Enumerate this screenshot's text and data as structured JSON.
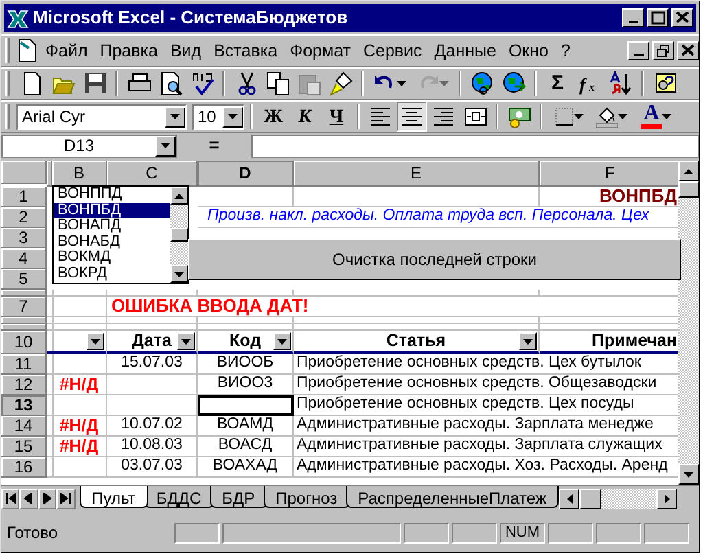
{
  "window": {
    "title": "Microsoft Excel - СистемаБюджетов"
  },
  "menu": [
    {
      "label": "Файл"
    },
    {
      "label": "Правка"
    },
    {
      "label": "Вид"
    },
    {
      "label": "Вставка"
    },
    {
      "label": "Формат"
    },
    {
      "label": "Сервис"
    },
    {
      "label": "Данные"
    },
    {
      "label": "Окно"
    },
    {
      "label": "?"
    }
  ],
  "standard_toolbar": [
    {
      "kind": "new",
      "disabled": false
    },
    {
      "kind": "open",
      "disabled": false
    },
    {
      "kind": "save",
      "disabled": false
    },
    {
      "kind": "sep"
    },
    {
      "kind": "print",
      "disabled": false
    },
    {
      "kind": "preview",
      "disabled": false
    },
    {
      "kind": "spell",
      "disabled": false
    },
    {
      "kind": "sep"
    },
    {
      "kind": "cut",
      "disabled": false
    },
    {
      "kind": "copy",
      "disabled": false
    },
    {
      "kind": "paste",
      "disabled": true
    },
    {
      "kind": "brush",
      "disabled": false
    },
    {
      "kind": "sep"
    },
    {
      "kind": "undo",
      "disabled": false
    },
    {
      "kind": "redo",
      "disabled": true
    },
    {
      "kind": "sep"
    },
    {
      "kind": "globe",
      "disabled": false
    },
    {
      "kind": "globe2",
      "disabled": false
    },
    {
      "kind": "sep"
    },
    {
      "kind": "text",
      "label": "Σ",
      "disabled": false
    },
    {
      "kind": "fx",
      "disabled": false
    },
    {
      "kind": "sort",
      "disabled": false
    },
    {
      "kind": "sep"
    },
    {
      "kind": "help",
      "disabled": false
    }
  ],
  "formatting_toolbar": {
    "font": "Arial Cyr",
    "size": "10",
    "bold": "Ж",
    "italic": "К",
    "underline": "Ч",
    "align": [
      {
        "kind": "left",
        "selected": false
      },
      {
        "kind": "center",
        "selected": true
      },
      {
        "kind": "right",
        "selected": false
      },
      {
        "kind": "merge",
        "selected": false
      }
    ],
    "font_color_letter": "A"
  },
  "formula_bar": {
    "name_box": "D13",
    "equals": "="
  },
  "columns": [
    {
      "selected": false
    },
    {
      "label": "B",
      "selected": false
    },
    {
      "label": "C",
      "selected": false
    },
    {
      "label": "D",
      "selected": true
    },
    {
      "label": "E",
      "selected": false
    },
    {
      "label": "F",
      "selected": false
    }
  ],
  "rows": [
    {
      "number": "1",
      "selected": false,
      "kind": "title",
      "f": "ВОНПБД"
    },
    {
      "number": "2",
      "selected": false,
      "kind": "note",
      "d": "Произв. накл. расходы. Оплата труда всп. Персонала. Цех"
    },
    {
      "number": "3",
      "selected": false,
      "kind": "data"
    },
    {
      "number": "4",
      "selected": false,
      "kind": "data"
    },
    {
      "number": "5",
      "selected": false,
      "kind": "data"
    },
    {
      "selected": false,
      "kind": "thin"
    },
    {
      "number": "7",
      "selected": false,
      "kind": "warning",
      "c": "ОШИБКА ВВОДА ДАТ!"
    },
    {
      "selected": false,
      "kind": "thin"
    },
    {
      "selected": false,
      "kind": "thin"
    },
    {
      "number": "10",
      "selected": false,
      "kind": "header",
      "c": "Дата",
      "d": "Код",
      "e": "Статья",
      "f": "Примечан"
    },
    {
      "number": "11",
      "selected": false,
      "kind": "data",
      "c": "15.07.03",
      "d": "ВИООБ",
      "e": "Приобретение основных средств. Цех бутылок"
    },
    {
      "number": "12",
      "selected": false,
      "kind": "data",
      "b": "#Н/Д",
      "d": "ВИОО3",
      "e": "Приобретение основных средств. Общезаводски"
    },
    {
      "number": "13",
      "selected": true,
      "kind": "data",
      "e": "Приобретение основных средств. Цех посуды"
    },
    {
      "number": "14",
      "selected": false,
      "kind": "data",
      "b": "#Н/Д",
      "c": "10.07.02",
      "d": "ВОАМД",
      "e": "Административные расходы. Зарплата менедже"
    },
    {
      "number": "15",
      "selected": false,
      "kind": "data",
      "b": "#Н/Д",
      "c": "10.08.03",
      "d": "ВОАСД",
      "e": "Административные расходы. Зарплата служащих"
    },
    {
      "number": "16",
      "selected": false,
      "kind": "data",
      "c": "03.07.03",
      "d": "ВОАХАД",
      "e": "Административные расходы. Хоз. Расходы. Аренд"
    }
  ],
  "list_box": [
    {
      "label": "ВОНППД",
      "selected": false
    },
    {
      "label": "ВОНПБД",
      "selected": true
    },
    {
      "label": "ВОНАПД",
      "selected": false
    },
    {
      "label": "ВОНАБД",
      "selected": false
    },
    {
      "label": "ВОКМД",
      "selected": false
    },
    {
      "label": "ВОКРД",
      "selected": false
    }
  ],
  "clear_button": {
    "label": "Очистка последней строки"
  },
  "sheet_tabs": [
    {
      "label": "Пульт",
      "selected": true
    },
    {
      "label": "БДДС",
      "selected": false
    },
    {
      "label": "БДР",
      "selected": false
    },
    {
      "label": "Прогноз",
      "selected": false
    },
    {
      "label": "РаспределенныеПлатеж",
      "selected": false
    }
  ],
  "status_bar": {
    "text": "Готово",
    "indicators": [
      {
        "kind": "blank"
      },
      {
        "kind": "wide"
      },
      {
        "kind": "blank"
      },
      {
        "kind": "blank"
      },
      {
        "label": "NUM",
        "kind": "blank"
      },
      {
        "kind": "blank"
      },
      {
        "kind": "blank"
      },
      {
        "kind": "blank"
      }
    ]
  }
}
